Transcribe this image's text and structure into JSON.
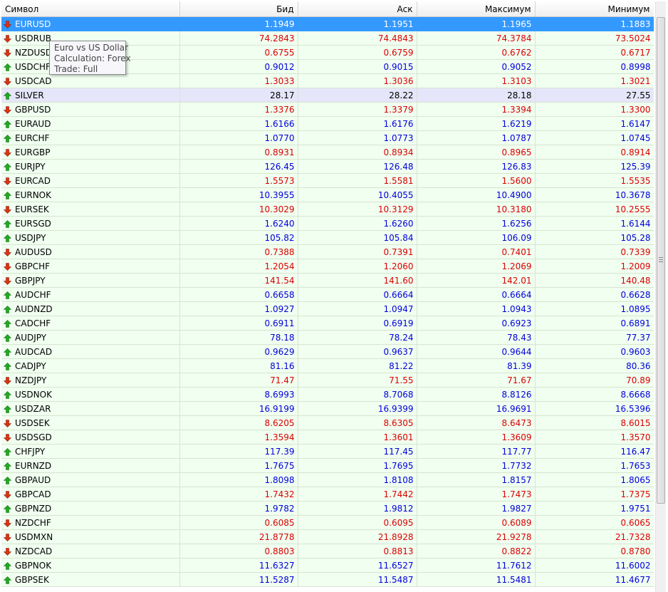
{
  "columns": [
    "Символ",
    "Бид",
    "Аск",
    "Максимум",
    "Минимум"
  ],
  "rows": [
    {
      "symbol": "EURUSD",
      "dir": "down",
      "bid": "1.1949",
      "ask": "1.1951",
      "high": "1.1965",
      "low": "1.1883",
      "state": "selected"
    },
    {
      "symbol": "USDRUB",
      "dir": "down",
      "bid": "74.2843",
      "ask": "74.4843",
      "high": "74.3784",
      "low": "73.5024"
    },
    {
      "symbol": "NZDUSD",
      "dir": "down",
      "bid": "0.6755",
      "ask": "0.6759",
      "high": "0.6762",
      "low": "0.6717"
    },
    {
      "symbol": "USDCHF",
      "dir": "up",
      "bid": "0.9012",
      "ask": "0.9015",
      "high": "0.9052",
      "low": "0.8998"
    },
    {
      "symbol": "USDCAD",
      "dir": "down",
      "bid": "1.3033",
      "ask": "1.3036",
      "high": "1.3103",
      "low": "1.3021"
    },
    {
      "symbol": "SILVER",
      "dir": "up",
      "bid": "28.17",
      "ask": "28.22",
      "high": "28.18",
      "low": "27.55",
      "state": "neutral"
    },
    {
      "symbol": "GBPUSD",
      "dir": "down",
      "bid": "1.3376",
      "ask": "1.3379",
      "high": "1.3394",
      "low": "1.3300"
    },
    {
      "symbol": "EURAUD",
      "dir": "up",
      "bid": "1.6166",
      "ask": "1.6176",
      "high": "1.6219",
      "low": "1.6147"
    },
    {
      "symbol": "EURCHF",
      "dir": "up",
      "bid": "1.0770",
      "ask": "1.0773",
      "high": "1.0787",
      "low": "1.0745"
    },
    {
      "symbol": "EURGBP",
      "dir": "down",
      "bid": "0.8931",
      "ask": "0.8934",
      "high": "0.8965",
      "low": "0.8914"
    },
    {
      "symbol": "EURJPY",
      "dir": "up",
      "bid": "126.45",
      "ask": "126.48",
      "high": "126.83",
      "low": "125.39"
    },
    {
      "symbol": "EURCAD",
      "dir": "down",
      "bid": "1.5573",
      "ask": "1.5581",
      "high": "1.5600",
      "low": "1.5535"
    },
    {
      "symbol": "EURNOK",
      "dir": "up",
      "bid": "10.3955",
      "ask": "10.4055",
      "high": "10.4900",
      "low": "10.3678"
    },
    {
      "symbol": "EURSEK",
      "dir": "down",
      "bid": "10.3029",
      "ask": "10.3129",
      "high": "10.3180",
      "low": "10.2555"
    },
    {
      "symbol": "EURSGD",
      "dir": "up",
      "bid": "1.6240",
      "ask": "1.6260",
      "high": "1.6256",
      "low": "1.6144"
    },
    {
      "symbol": "USDJPY",
      "dir": "up",
      "bid": "105.82",
      "ask": "105.84",
      "high": "106.09",
      "low": "105.28"
    },
    {
      "symbol": "AUDUSD",
      "dir": "down",
      "bid": "0.7388",
      "ask": "0.7391",
      "high": "0.7401",
      "low": "0.7339"
    },
    {
      "symbol": "GBPCHF",
      "dir": "down",
      "bid": "1.2054",
      "ask": "1.2060",
      "high": "1.2069",
      "low": "1.2009"
    },
    {
      "symbol": "GBPJPY",
      "dir": "down",
      "bid": "141.54",
      "ask": "141.60",
      "high": "142.01",
      "low": "140.48"
    },
    {
      "symbol": "AUDCHF",
      "dir": "up",
      "bid": "0.6658",
      "ask": "0.6664",
      "high": "0.6664",
      "low": "0.6628"
    },
    {
      "symbol": "AUDNZD",
      "dir": "up",
      "bid": "1.0927",
      "ask": "1.0947",
      "high": "1.0943",
      "low": "1.0895"
    },
    {
      "symbol": "CADCHF",
      "dir": "up",
      "bid": "0.6911",
      "ask": "0.6919",
      "high": "0.6923",
      "low": "0.6891"
    },
    {
      "symbol": "AUDJPY",
      "dir": "up",
      "bid": "78.18",
      "ask": "78.24",
      "high": "78.43",
      "low": "77.37"
    },
    {
      "symbol": "AUDCAD",
      "dir": "up",
      "bid": "0.9629",
      "ask": "0.9637",
      "high": "0.9644",
      "low": "0.9603"
    },
    {
      "symbol": "CADJPY",
      "dir": "up",
      "bid": "81.16",
      "ask": "81.22",
      "high": "81.39",
      "low": "80.36"
    },
    {
      "symbol": "NZDJPY",
      "dir": "down",
      "bid": "71.47",
      "ask": "71.55",
      "high": "71.67",
      "low": "70.89"
    },
    {
      "symbol": "USDNOK",
      "dir": "up",
      "bid": "8.6993",
      "ask": "8.7068",
      "high": "8.8126",
      "low": "8.6668"
    },
    {
      "symbol": "USDZAR",
      "dir": "up",
      "bid": "16.9199",
      "ask": "16.9399",
      "high": "16.9691",
      "low": "16.5396"
    },
    {
      "symbol": "USDSEK",
      "dir": "down",
      "bid": "8.6205",
      "ask": "8.6305",
      "high": "8.6473",
      "low": "8.6015"
    },
    {
      "symbol": "USDSGD",
      "dir": "down",
      "bid": "1.3594",
      "ask": "1.3601",
      "high": "1.3609",
      "low": "1.3570"
    },
    {
      "symbol": "CHFJPY",
      "dir": "up",
      "bid": "117.39",
      "ask": "117.45",
      "high": "117.77",
      "low": "116.47"
    },
    {
      "symbol": "EURNZD",
      "dir": "up",
      "bid": "1.7675",
      "ask": "1.7695",
      "high": "1.7732",
      "low": "1.7653"
    },
    {
      "symbol": "GBPAUD",
      "dir": "up",
      "bid": "1.8098",
      "ask": "1.8108",
      "high": "1.8157",
      "low": "1.8065"
    },
    {
      "symbol": "GBPCAD",
      "dir": "down",
      "bid": "1.7432",
      "ask": "1.7442",
      "high": "1.7473",
      "low": "1.7375"
    },
    {
      "symbol": "GBPNZD",
      "dir": "up",
      "bid": "1.9782",
      "ask": "1.9812",
      "high": "1.9827",
      "low": "1.9751"
    },
    {
      "symbol": "NZDCHF",
      "dir": "down",
      "bid": "0.6085",
      "ask": "0.6095",
      "high": "0.6089",
      "low": "0.6065"
    },
    {
      "symbol": "USDMXN",
      "dir": "down",
      "bid": "21.8778",
      "ask": "21.8928",
      "high": "21.9278",
      "low": "21.7328"
    },
    {
      "symbol": "NZDCAD",
      "dir": "down",
      "bid": "0.8803",
      "ask": "0.8813",
      "high": "0.8822",
      "low": "0.8780"
    },
    {
      "symbol": "GBPNOK",
      "dir": "up",
      "bid": "11.6327",
      "ask": "11.6527",
      "high": "11.7612",
      "low": "11.6002"
    },
    {
      "symbol": "GBPSEK",
      "dir": "up",
      "bid": "11.5287",
      "ask": "11.5487",
      "high": "11.5481",
      "low": "11.4677"
    }
  ],
  "tooltip": {
    "description": "Euro vs US Dollar",
    "calculation": "Calculation: Forex",
    "trade": "Trade: Full"
  },
  "colors": {
    "up_text": "#0000dd",
    "down_text": "#dd0000",
    "up_arrow": "#22aa22",
    "down_arrow": "#dd3311",
    "selected_row": "#3399ff",
    "row_background": "#f0fff0",
    "highlight_row": "#e6e6fa"
  },
  "icons": {
    "up": "arrow-up-icon",
    "down": "arrow-down-icon"
  }
}
